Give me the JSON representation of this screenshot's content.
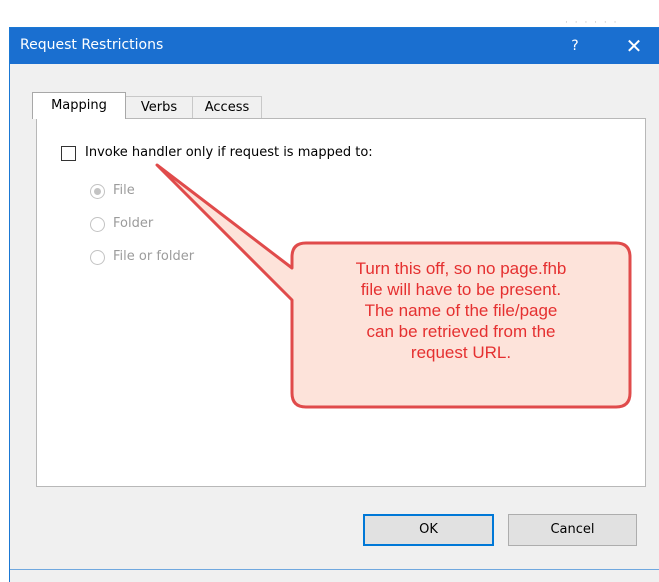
{
  "window": {
    "title": "Request Restrictions",
    "help_label": "?",
    "close_label": "✕"
  },
  "tabs": [
    {
      "label": "Mapping",
      "active": true
    },
    {
      "label": "Verbs",
      "active": false
    },
    {
      "label": "Access",
      "active": false
    }
  ],
  "mapping": {
    "invoke_checkbox": {
      "label": "Invoke handler only if request is mapped to:",
      "checked": false
    },
    "radios": [
      {
        "label": "File",
        "selected": true,
        "enabled": false
      },
      {
        "label": "Folder",
        "selected": false,
        "enabled": false
      },
      {
        "label": "File or folder",
        "selected": false,
        "enabled": false
      }
    ]
  },
  "callout": {
    "lines": [
      "Turn this off, so no page.fhb",
      "file will have to be present.",
      "The name of the file/page",
      "can be retrieved from the",
      "request URL."
    ]
  },
  "buttons": {
    "ok_label": "OK",
    "cancel_label": "Cancel"
  },
  "colors": {
    "titlebar": "#1a6fd0",
    "callout_fill": "#fde3da",
    "callout_border": "#e04b4b",
    "callout_text": "#e53030"
  }
}
